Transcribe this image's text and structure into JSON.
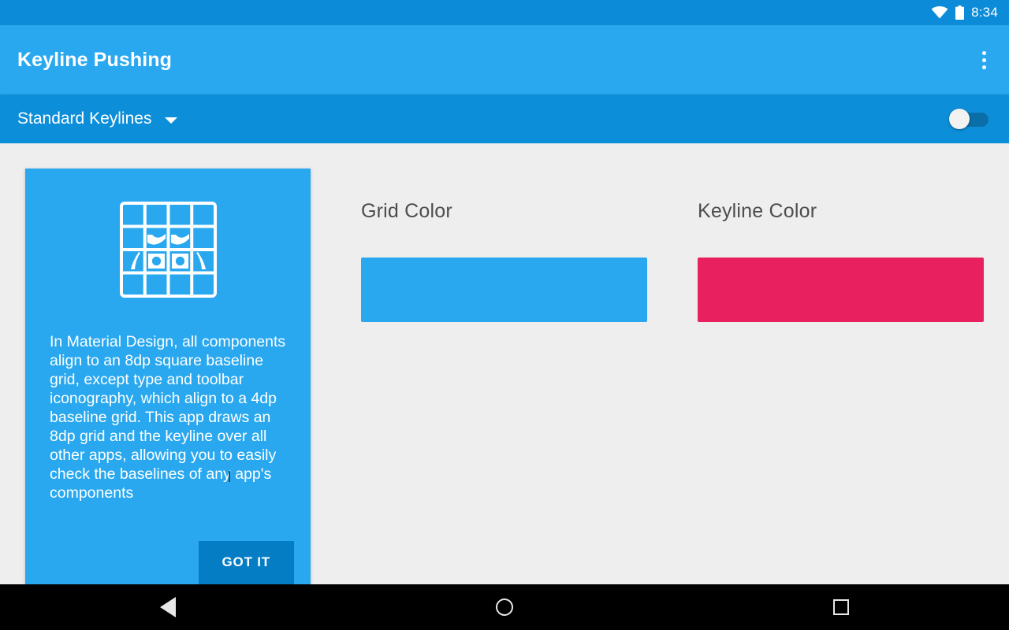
{
  "status_bar": {
    "time": "8:34",
    "wifi_icon": "wifi-icon",
    "battery_icon": "battery-icon",
    "background_color": "#0b8bd8"
  },
  "app_bar": {
    "title": "Keyline Pushing",
    "overflow_icon": "overflow-menu-icon",
    "background_color": "#29a8ef"
  },
  "sub_toolbar": {
    "spinner_value": "Standard Keylines",
    "spinner_caret_icon": "chevron-down-icon",
    "toggle_state": "off",
    "background_color": "#0d8ed9"
  },
  "info_card": {
    "icon_name": "baseline-grid-icon",
    "body_text": "In Material Design, all components align to an 8dp square baseline grid, except type and toolbar iconography, which align to a 4dp baseline grid. This app draws an 8dp grid and the keyline over all other apps, allowing you to easily check the baselines of any app's components",
    "action_label": "GOT IT",
    "background_color": "#29a8ef",
    "action_background_color": "#057dc4"
  },
  "color_pickers": [
    {
      "label": "Grid Color",
      "swatch_color": "#29a8ef",
      "name": "grid-color-swatch"
    },
    {
      "label": "Keyline Color",
      "swatch_color": "#e82060",
      "name": "keyline-color-swatch"
    }
  ],
  "nav_bar": {
    "back_icon": "back-triangle-icon",
    "home_icon": "home-circle-icon",
    "recents_icon": "recents-square-icon",
    "background_color": "#000000"
  }
}
